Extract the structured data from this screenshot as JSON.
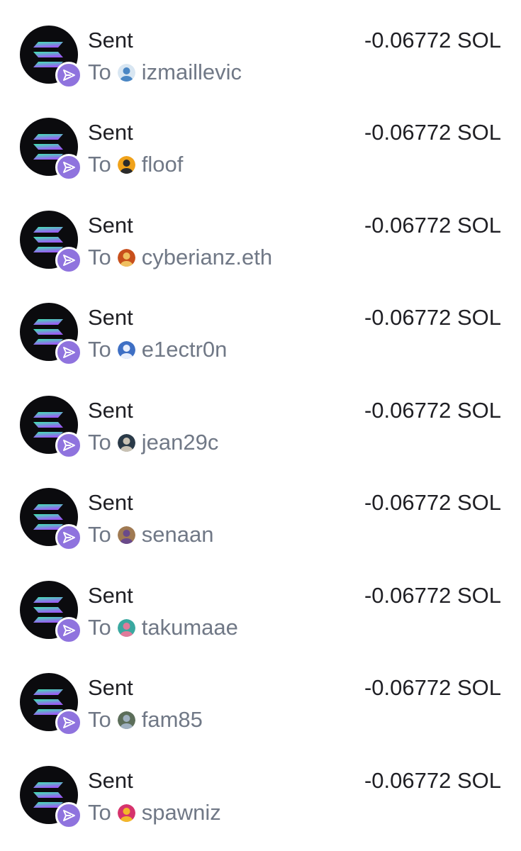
{
  "transactions": [
    {
      "title": "Sent",
      "to_label": "To",
      "recipient": "izmaillevic",
      "amount": "-0.06772 SOL",
      "avatar_colors": [
        "#d8e6f2",
        "#4a86c4"
      ],
      "avatar_icon": "landscape-avatar-icon"
    },
    {
      "title": "Sent",
      "to_label": "To",
      "recipient": "floof",
      "amount": "-0.06772 SOL",
      "avatar_colors": [
        "#f0a21a",
        "#2b2b2b"
      ],
      "avatar_icon": "character-avatar-icon"
    },
    {
      "title": "Sent",
      "to_label": "To",
      "recipient": "cyberianz.eth",
      "amount": "-0.06772 SOL",
      "avatar_colors": [
        "#c8501c",
        "#f0c060"
      ],
      "avatar_icon": "lion-avatar-icon"
    },
    {
      "title": "Sent",
      "to_label": "To",
      "recipient": "e1ectr0n",
      "amount": "-0.06772 SOL",
      "avatar_colors": [
        "#3e6fc4",
        "#e8eefc"
      ],
      "avatar_icon": "character-avatar-icon"
    },
    {
      "title": "Sent",
      "to_label": "To",
      "recipient": "jean29c",
      "amount": "-0.06772 SOL",
      "avatar_colors": [
        "#2a3a48",
        "#c9c2b4"
      ],
      "avatar_icon": "pixel-avatar-icon"
    },
    {
      "title": "Sent",
      "to_label": "To",
      "recipient": "senaan",
      "amount": "-0.06772 SOL",
      "avatar_colors": [
        "#a07a52",
        "#6a4a8a"
      ],
      "avatar_icon": "character-avatar-icon"
    },
    {
      "title": "Sent",
      "to_label": "To",
      "recipient": "takumaae",
      "amount": "-0.06772 SOL",
      "avatar_colors": [
        "#3aa8a0",
        "#e07a9a"
      ],
      "avatar_icon": "anime-avatar-icon"
    },
    {
      "title": "Sent",
      "to_label": "To",
      "recipient": "fam85",
      "amount": "-0.06772 SOL",
      "avatar_colors": [
        "#5c6e5a",
        "#9fb0c0"
      ],
      "avatar_icon": "mountain-avatar-icon"
    },
    {
      "title": "Sent",
      "to_label": "To",
      "recipient": "spawniz",
      "amount": "-0.06772 SOL",
      "avatar_colors": [
        "#d6336c",
        "#f2b82a"
      ],
      "avatar_icon": "abstract-avatar-icon"
    }
  ],
  "icons": {
    "token": "solana-logo-icon",
    "badge": "send-arrow-icon"
  },
  "colors": {
    "badge_purple": "#8f73de",
    "sol_gradient_start": "#3ee8b0",
    "sol_gradient_end": "#9b5cf5",
    "title_text": "#1f1f24",
    "secondary_text": "#707886"
  }
}
